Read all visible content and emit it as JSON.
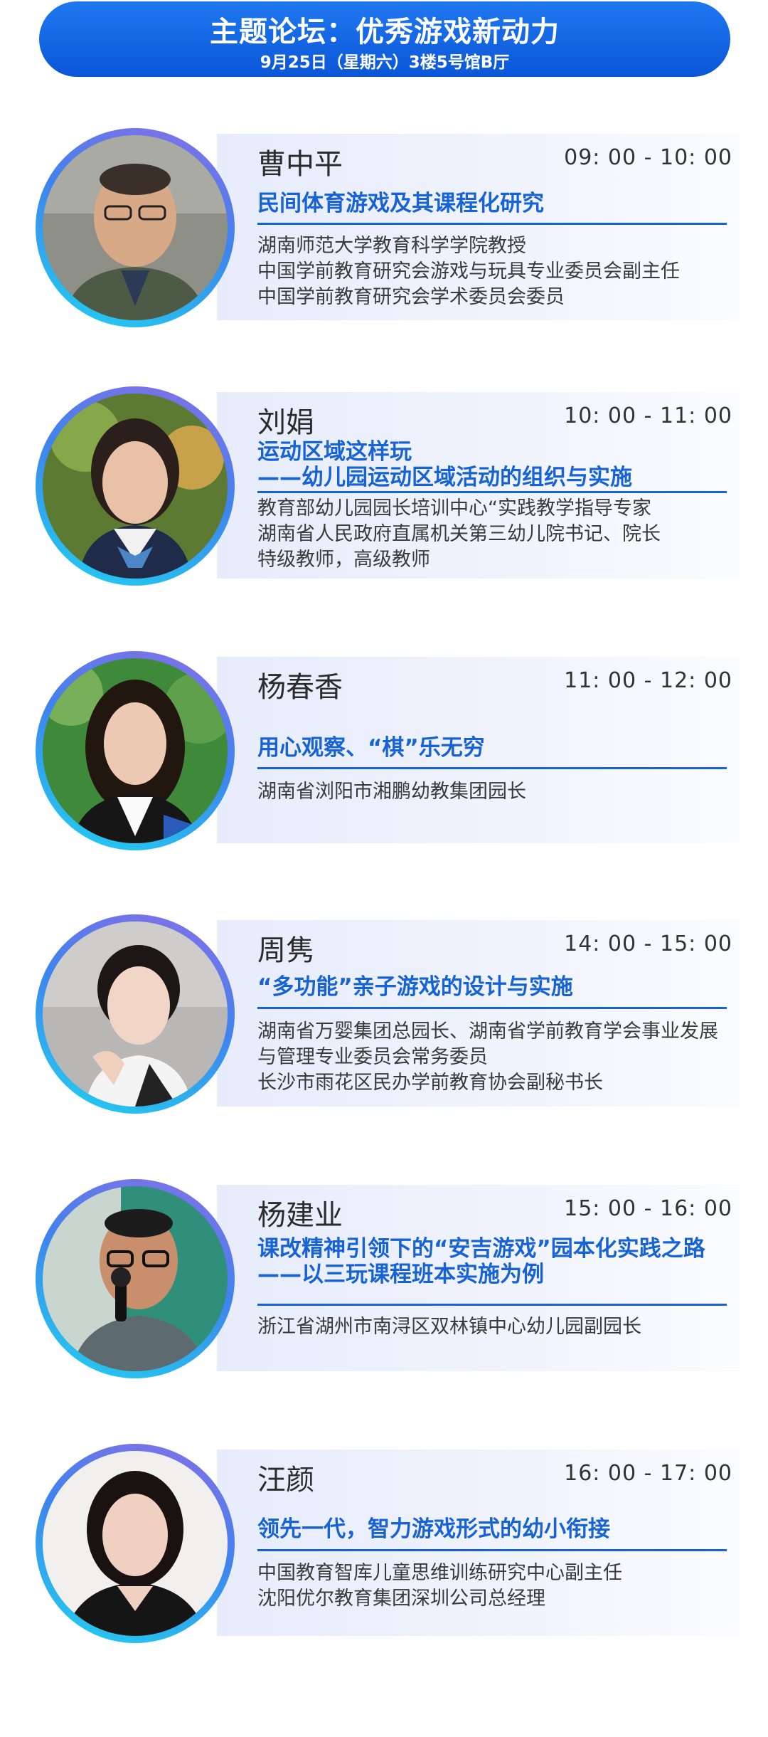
{
  "header": {
    "title": "主题论坛：优秀游戏新动力",
    "subtitle": "9月25日（星期六）3楼5号馆B厅"
  },
  "speakers": [
    {
      "name": "曹中平",
      "time": "09: 00 - 10: 00",
      "topic": [
        "民间体育游戏及其课程化研究"
      ],
      "bio": [
        "湖南师范大学教育科学学院教授",
        "中国学前教育研究会游戏与玩具专业委员会副主任",
        "中国学前教育研究会学术委员会委员"
      ]
    },
    {
      "name": "刘娟",
      "time": "10: 00 - 11: 00",
      "topic": [
        "运动区域这样玩",
        "——幼儿园运动区域活动的组织与实施"
      ],
      "bio": [
        "教育部幼儿园园长培训中心“实践教学指导专家",
        "湖南省人民政府直属机关第三幼儿院书记、院长",
        "特级教师，高级教师"
      ]
    },
    {
      "name": "杨春香",
      "time": "11: 00 - 12: 00",
      "topic": [
        "用心观察、“棋”乐无穷"
      ],
      "bio": [
        "湖南省浏阳市湘鹏幼教集团园长"
      ]
    },
    {
      "name": "周隽",
      "time": "14: 00 - 15: 00",
      "topic": [
        "“多功能”亲子游戏的设计与实施"
      ],
      "bio": [
        "湖南省万婴集团总园长、湖南省学前教育学会事业发展",
        "与管理专业委员会常务委员",
        "长沙市雨花区民办学前教育协会副秘书长"
      ]
    },
    {
      "name": "杨建业",
      "time": "15: 00 - 16: 00",
      "topic": [
        "课改精神引领下的“安吉游戏”园本化实践之路",
        "——以三玩课程班本实施为例"
      ],
      "bio": [
        "浙江省湖州市南浔区双林镇中心幼儿园副园长"
      ]
    },
    {
      "name": "汪颜",
      "time": "16: 00 - 17: 00",
      "topic": [
        "领先一代，智力游戏形式的幼小衔接"
      ],
      "bio": [
        "中国教育智库儿童思维训练研究中心副主任",
        "沈阳优尔教育集团深圳公司总经理"
      ]
    }
  ],
  "colors": {
    "accent": "#1763d6",
    "header_bg": "#0b56d8",
    "card_bg": "#e7ecfb"
  }
}
